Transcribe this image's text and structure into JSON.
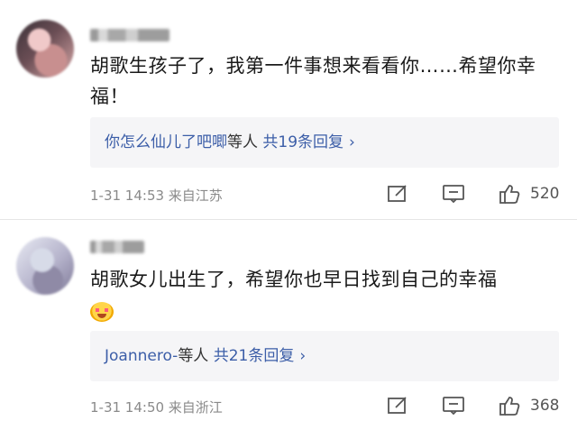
{
  "comments": [
    {
      "text": "胡歌生孩子了，我第一件事想来看看你……希望你幸福！",
      "replies": {
        "who": "你怎么仙儿了吧唧",
        "mid": "等人",
        "count": "共19条回复",
        "chev": "›"
      },
      "time": "1-31 14:53 来自江苏",
      "likes": "520"
    },
    {
      "text": "胡歌女儿出生了，希望你也早日找到自己的幸福",
      "replies": {
        "who": "Joannero-",
        "mid": "等人",
        "count": "共21条回复",
        "chev": "›"
      },
      "time": "1-31 14:50 来自浙江",
      "likes": "368"
    }
  ],
  "icons": {
    "emoji": "kiss-blush-emoji",
    "edit": "share-edit-icon",
    "comment": "comment-icon",
    "like": "thumbs-up-icon"
  }
}
